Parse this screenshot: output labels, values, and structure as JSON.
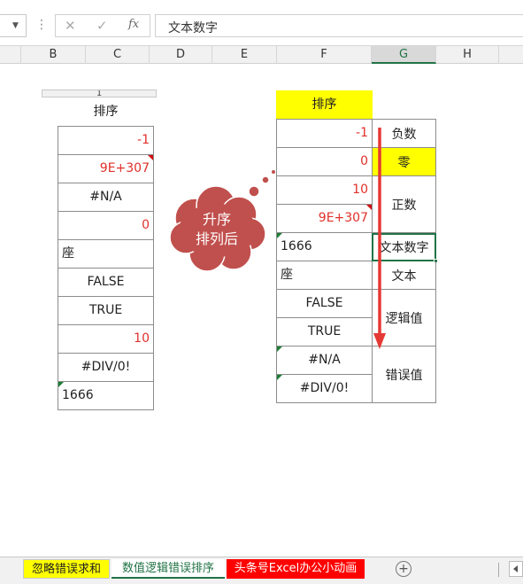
{
  "formula_bar": {
    "cancel_glyph": "✕",
    "enter_glyph": "✓",
    "fx_glyph": "fx",
    "content": "文本数字"
  },
  "columns": [
    "B",
    "C",
    "D",
    "E",
    "F",
    "G",
    "H"
  ],
  "selected_column": "G",
  "left_table": {
    "header_partial": "1",
    "header": "排序",
    "cells": [
      "-1",
      "9E+307",
      "#N/A",
      "0",
      "座",
      "FALSE",
      "TRUE",
      "10",
      "#DIV/0!",
      "1666"
    ]
  },
  "callout": {
    "line1": "升序",
    "line2": "排列后"
  },
  "right_table": {
    "header": "排序",
    "cells": [
      "-1",
      "0",
      "10",
      "9E+307",
      "1666",
      "座",
      "FALSE",
      "TRUE",
      "#N/A",
      "#DIV/0!"
    ],
    "categories": [
      "负数",
      "零",
      "正数",
      "文本数字",
      "文本",
      "逻辑值",
      "错误值"
    ]
  },
  "sheet_tabs": [
    "忽略错误求和",
    "数值逻辑错误排序",
    "头条号Excel办公小动画"
  ],
  "active_sheet": "数值逻辑错误排序",
  "add_sheet_glyph": "+",
  "colors": {
    "yellow": "#ffff00",
    "red_text": "#e0302a",
    "callout": "#c0504d",
    "excel_green": "#217346",
    "tab_red": "#ff0000"
  }
}
